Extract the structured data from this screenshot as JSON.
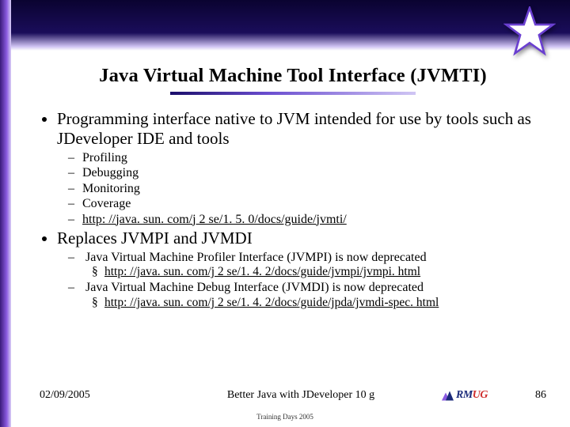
{
  "title": "Java Virtual Machine Tool Interface (JVMTI)",
  "bullets": {
    "b1": "Programming interface native to JVM intended for use by tools such as JDeveloper IDE and tools",
    "b1_sub": {
      "s1": "Profiling",
      "s2": "Debugging",
      "s3": "Monitoring",
      "s4": "Coverage",
      "s5": "http: //java. sun. com/j 2 se/1. 5. 0/docs/guide/jvmti/"
    },
    "b2": "Replaces JVMPI and JVMDI",
    "b2_sub": {
      "s1": "Java Virtual Machine Profiler Interface (JVMPI) is now deprecated",
      "s1_link": "http: //java. sun. com/j 2 se/1. 4. 2/docs/guide/jvmpi/jvmpi. html",
      "s2": "Java Virtual Machine Debug Interface (JVMDI) is now deprecated",
      "s2_link": "http: //java. sun. com/j 2 se/1. 4. 2/docs/guide/jpda/jvmdi-spec. html"
    }
  },
  "footer": {
    "date": "02/09/2005",
    "center": "Better Java with JDeveloper 10 g",
    "page": "86",
    "logo_main": "RM",
    "logo_suffix": "UG",
    "tagline": "Training Days 2005"
  }
}
